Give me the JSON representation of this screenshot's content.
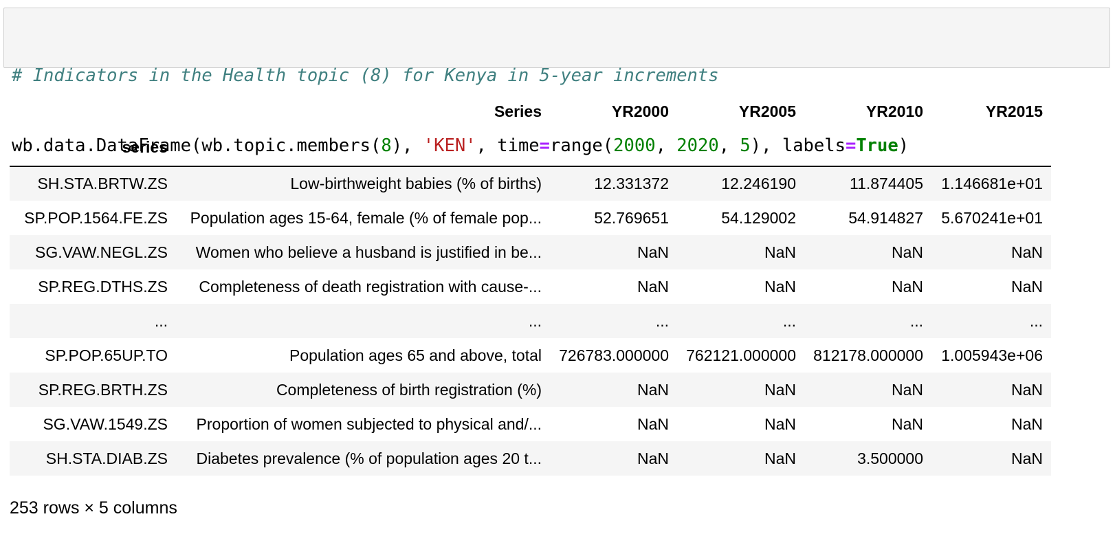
{
  "code_cell": {
    "comment": "# Indicators in the Health topic (8) for Kenya in 5-year increments",
    "line2": {
      "p1": "wb.data.DataFrame(wb.topic.members(",
      "n1": "8",
      "p2": "), ",
      "s1": "'KEN'",
      "p3": ", time",
      "op1": "=",
      "p4": "range(",
      "n2": "2000",
      "p5": ", ",
      "n3": "2020",
      "p6": ", ",
      "n4": "5",
      "p7": "), labels",
      "op2": "=",
      "kw1": "True",
      "p8": ")"
    }
  },
  "table": {
    "header_row1": [
      "",
      "Series",
      "YR2000",
      "YR2005",
      "YR2010",
      "YR2015"
    ],
    "index_name": "series",
    "rows": [
      [
        "SH.STA.BRTW.ZS",
        "Low-birthweight babies (% of births)",
        "12.331372",
        "12.246190",
        "11.874405",
        "1.146681e+01"
      ],
      [
        "SP.POP.1564.FE.ZS",
        "Population ages 15-64, female (% of female pop...",
        "52.769651",
        "54.129002",
        "54.914827",
        "5.670241e+01"
      ],
      [
        "SG.VAW.NEGL.ZS",
        "Women who believe a husband is justified in be...",
        "NaN",
        "NaN",
        "NaN",
        "NaN"
      ],
      [
        "SP.REG.DTHS.ZS",
        "Completeness of death registration with cause-...",
        "NaN",
        "NaN",
        "NaN",
        "NaN"
      ],
      [
        "...",
        "...",
        "...",
        "...",
        "...",
        "..."
      ],
      [
        "SP.POP.65UP.TO",
        "Population ages 65 and above, total",
        "726783.000000",
        "762121.000000",
        "812178.000000",
        "1.005943e+06"
      ],
      [
        "SP.REG.BRTH.ZS",
        "Completeness of birth registration (%)",
        "NaN",
        "NaN",
        "NaN",
        "NaN"
      ],
      [
        "SG.VAW.1549.ZS",
        "Proportion of women subjected to physical and/...",
        "NaN",
        "NaN",
        "NaN",
        "NaN"
      ],
      [
        "SH.STA.DIAB.ZS",
        "Diabetes prevalence (% of population ages 20 t...",
        "NaN",
        "NaN",
        "3.500000",
        "NaN"
      ]
    ]
  },
  "dimensions": "253 rows × 5 columns"
}
